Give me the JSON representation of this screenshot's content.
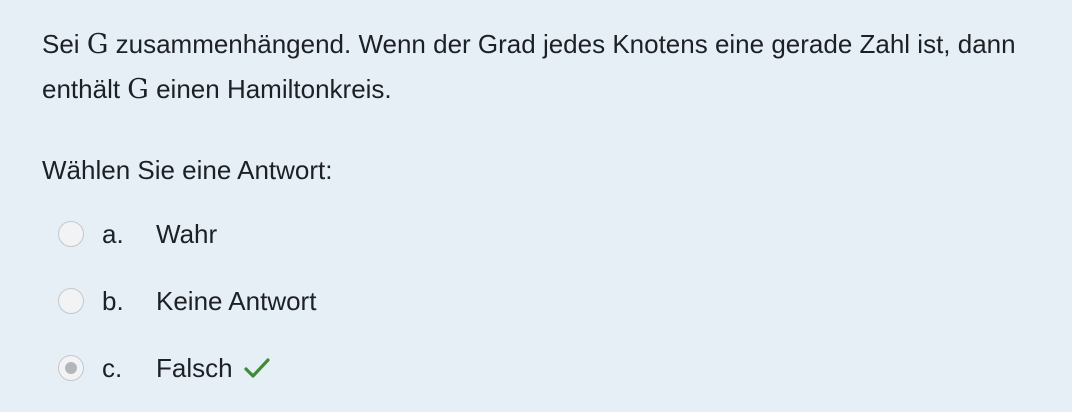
{
  "question": {
    "part1": "Sei ",
    "var1": "G",
    "part2": " zusammenhängend. Wenn der Grad jedes Knotens eine gerade Zahl ist, dann enthält ",
    "var2": "G",
    "part3": " einen Hamiltonkreis."
  },
  "prompt": "Wählen Sie eine Antwort:",
  "answers": [
    {
      "letter": "a.",
      "label": "Wahr",
      "selected": false
    },
    {
      "letter": "b.",
      "label": "Keine Antwort",
      "selected": false
    },
    {
      "letter": "c.",
      "label": "Falsch",
      "selected": true,
      "correct": true
    }
  ],
  "colors": {
    "panel_background": "#e6eff6",
    "correct_check": "#3f8a36"
  },
  "icons": {
    "correct": "checkmark-icon"
  }
}
